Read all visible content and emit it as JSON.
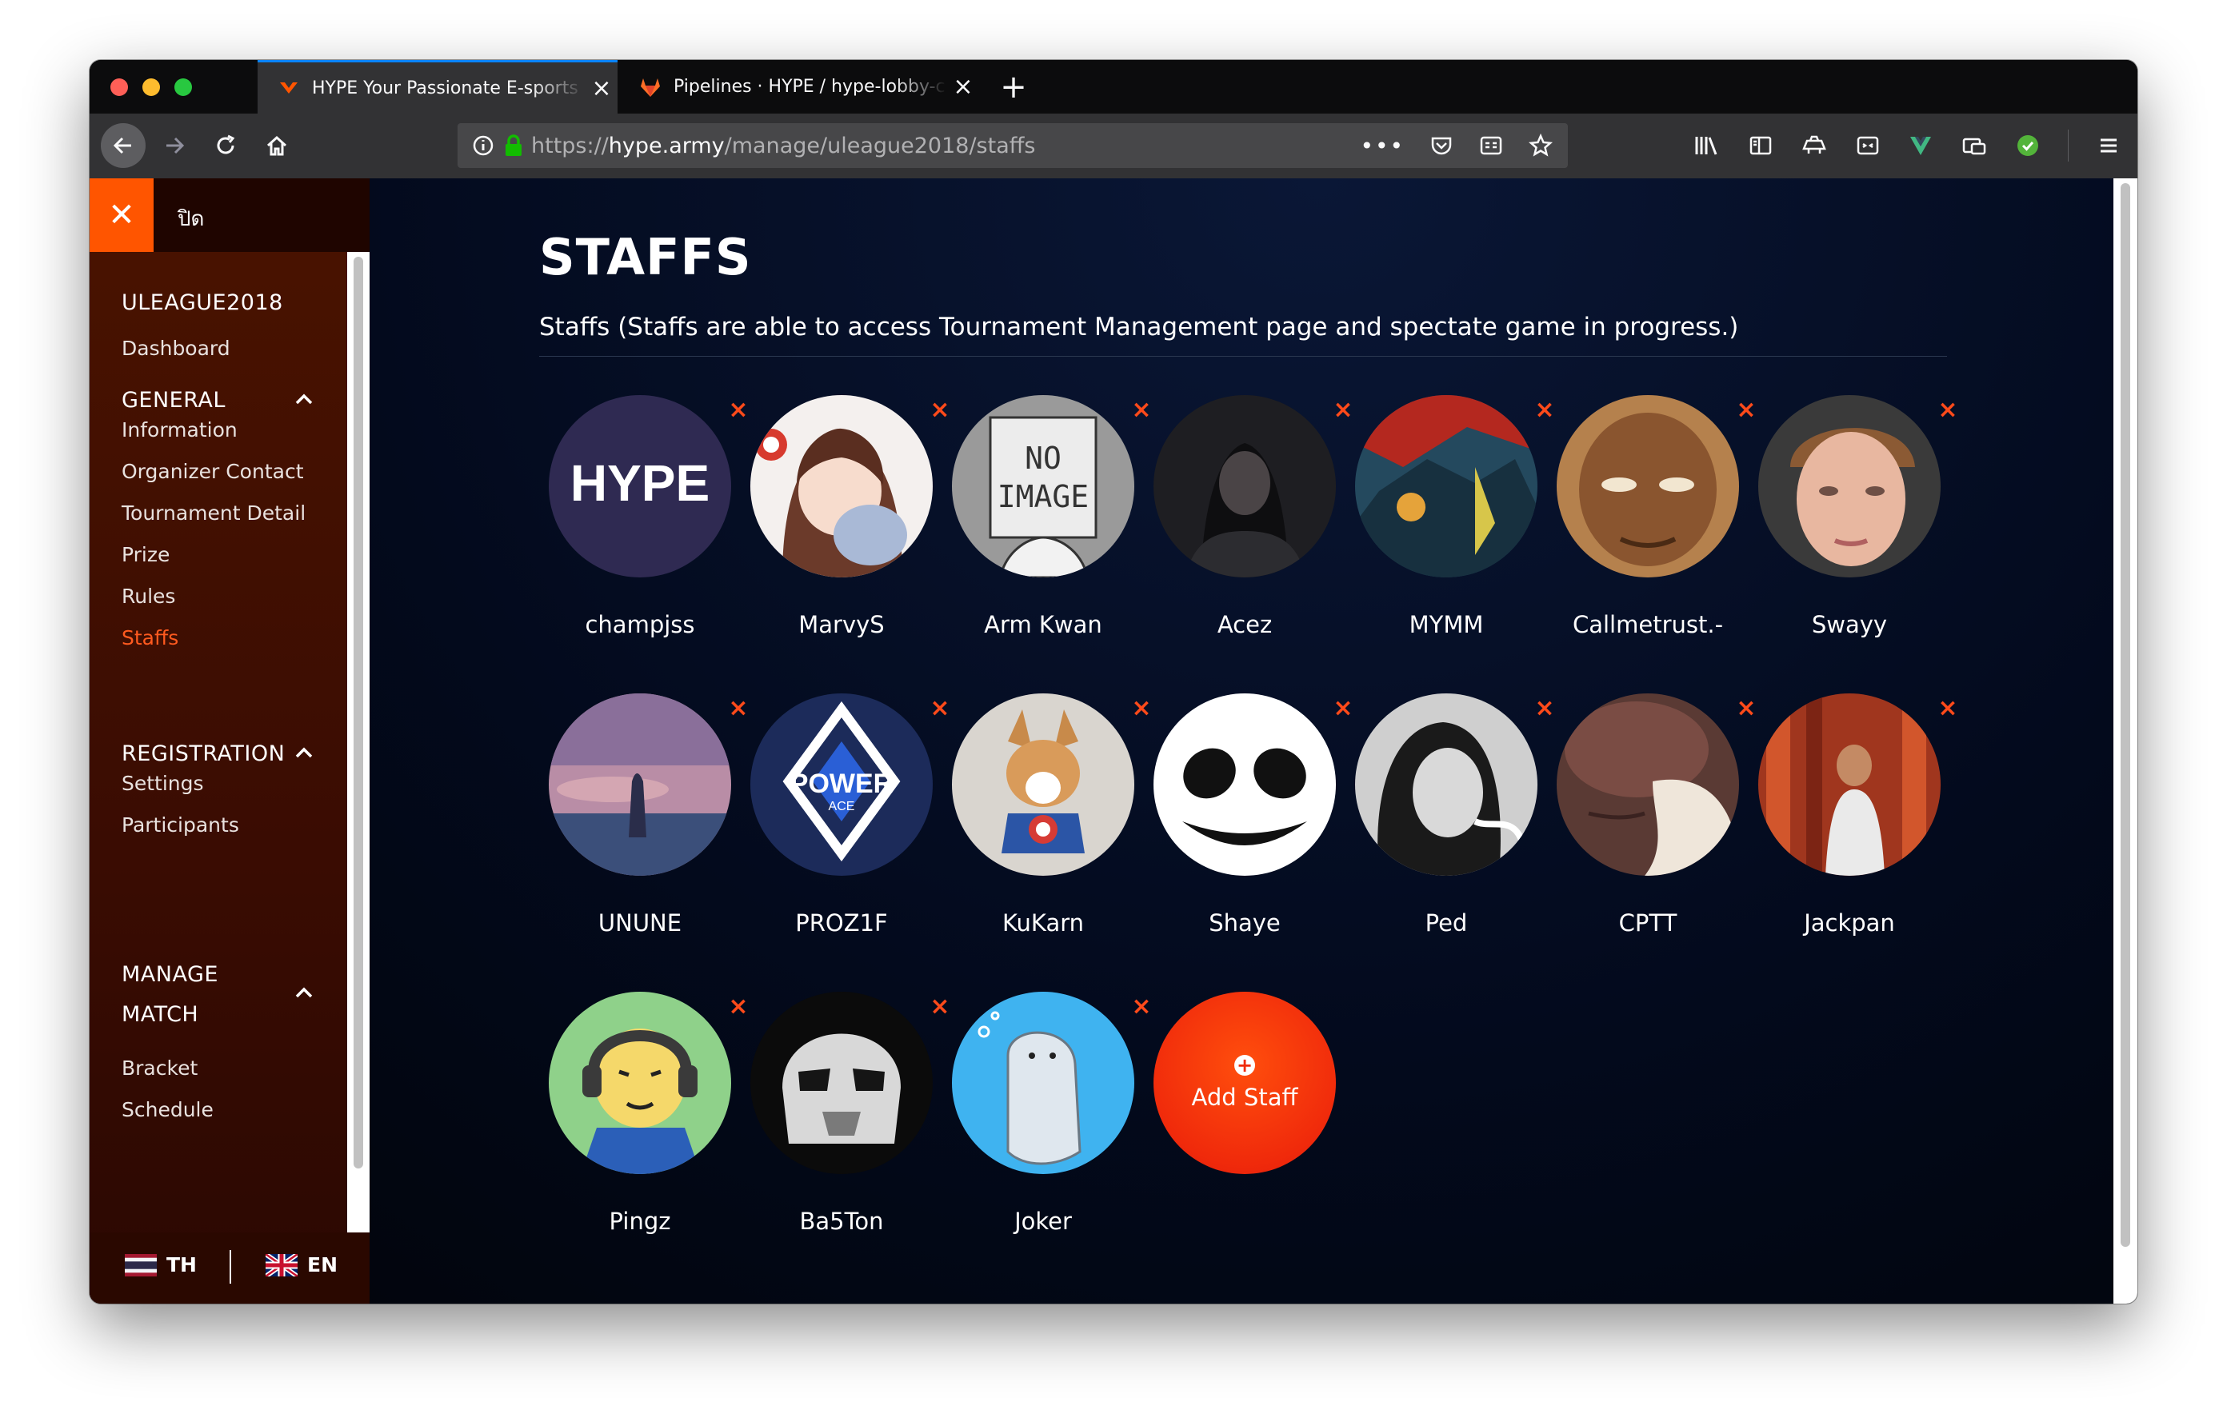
{
  "browser": {
    "tabs": [
      {
        "title": "HYPE Your Passionate E-sports",
        "icon": "hype-favicon-icon",
        "active": true
      },
      {
        "title": "Pipelines · HYPE / hype-lobby-c",
        "icon": "gitlab-favicon-icon",
        "active": false
      }
    ],
    "url_scheme": "https://",
    "url_host": "hype.army",
    "url_path": "/manage/uleague2018/staffs"
  },
  "sidebar": {
    "close_label": "ปิด",
    "tournament": "ULEAGUE2018",
    "dashboard": "Dashboard",
    "sections": [
      {
        "title": "GENERAL",
        "items": [
          "Information",
          "Organizer Contact",
          "Tournament Detail",
          "Prize",
          "Rules",
          "Staffs"
        ]
      },
      {
        "title": "REGISTRATION",
        "items": [
          "Settings",
          "Participants"
        ]
      },
      {
        "title_line1": "MANAGE",
        "title_line2": "MATCH",
        "items": [
          "Bracket",
          "Schedule"
        ]
      }
    ],
    "active_item": "Staffs",
    "languages": [
      {
        "code": "TH",
        "flag": "thai-flag-icon"
      },
      {
        "code": "EN",
        "flag": "uk-flag-icon"
      }
    ]
  },
  "main": {
    "title": "STAFFS",
    "description": "Staffs (Staffs are able to access Tournament Management page and spectate game in progress.)",
    "remove_glyph": "×",
    "staff": [
      {
        "name": "champjss",
        "avatar": "hype-logo-avatar",
        "avatar_text": "HYPE"
      },
      {
        "name": "MarvyS",
        "avatar": "anime-girl-avatar"
      },
      {
        "name": "Arm Kwan",
        "avatar": "no-image-avatar",
        "avatar_text_1": "NO",
        "avatar_text_2": "IMAGE"
      },
      {
        "name": "Acez",
        "avatar": "dark-portrait-avatar"
      },
      {
        "name": "MYMM",
        "avatar": "mech-art-avatar"
      },
      {
        "name": "Callmetrust.-",
        "avatar": "cartoon-face-avatar"
      },
      {
        "name": "Swayy",
        "avatar": "photo-face-avatar"
      },
      {
        "name": "UNUNE",
        "avatar": "sunset-silhouette-avatar"
      },
      {
        "name": "PROZ1F",
        "avatar": "power-ace-logo-avatar",
        "avatar_text_1": "POWER",
        "avatar_text_2": "ACE"
      },
      {
        "name": "KuKarn",
        "avatar": "corgi-avatar"
      },
      {
        "name": "Shaye",
        "avatar": "marshmello-avatar"
      },
      {
        "name": "Ped",
        "avatar": "bw-portrait-avatar"
      },
      {
        "name": "CPTT",
        "avatar": "pillow-sleeper-avatar"
      },
      {
        "name": "Jackpan",
        "avatar": "red-temple-avatar"
      },
      {
        "name": "Pingz",
        "avatar": "cartoon-headphones-avatar"
      },
      {
        "name": "Ba5Ton",
        "avatar": "stormtrooper-avatar"
      },
      {
        "name": "Joker",
        "avatar": "seal-cartoon-avatar"
      }
    ],
    "add_staff_label": "Add Staff"
  },
  "colors": {
    "accent": "#ff5500",
    "remove": "#ff4a1a",
    "add_button": "#f02a0b",
    "page_bg": "#030a1d",
    "sidebar_bg": "#4a1300"
  }
}
